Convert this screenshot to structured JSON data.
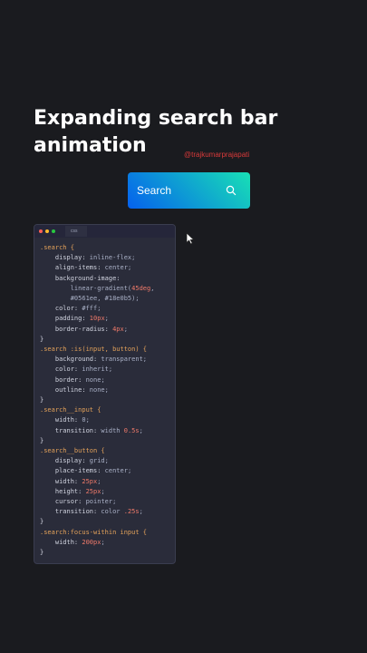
{
  "heading": {
    "line1": "Expanding search bar",
    "line2": "animation"
  },
  "credit": "@trajkumarprajapati",
  "demo": {
    "search_text": "Search",
    "search_icon": "search-icon",
    "gradient_start": "#0561ee",
    "gradient_end": "#18e0b5"
  },
  "editor": {
    "tab_label": "css",
    "window_dots": [
      "#ff5f57",
      "#febc2e",
      "#28c840"
    ],
    "code": [
      ".search {",
      "    display: inline-flex;",
      "    align-items: center;",
      "    background-image:",
      "        linear-gradient(45deg,",
      "        #0561ee, #18e0b5);",
      "    color: #fff;",
      "    padding: 10px;",
      "    border-radius: 4px;",
      "}",
      ".search :is(input, button) {",
      "    background: transparent;",
      "    color: inherit;",
      "    border: none;",
      "    outline: none;",
      "}",
      ".search__input {",
      "    width: 0;",
      "    transition: width 0.5s;",
      "}",
      ".search__button {",
      "    display: grid;",
      "    place-items: center;",
      "    width: 25px;",
      "    height: 25px;",
      "    cursor: pointer;",
      "    transition: color .25s;",
      "}",
      ".search:focus-within input {",
      "    width: 200px;",
      "}"
    ]
  }
}
